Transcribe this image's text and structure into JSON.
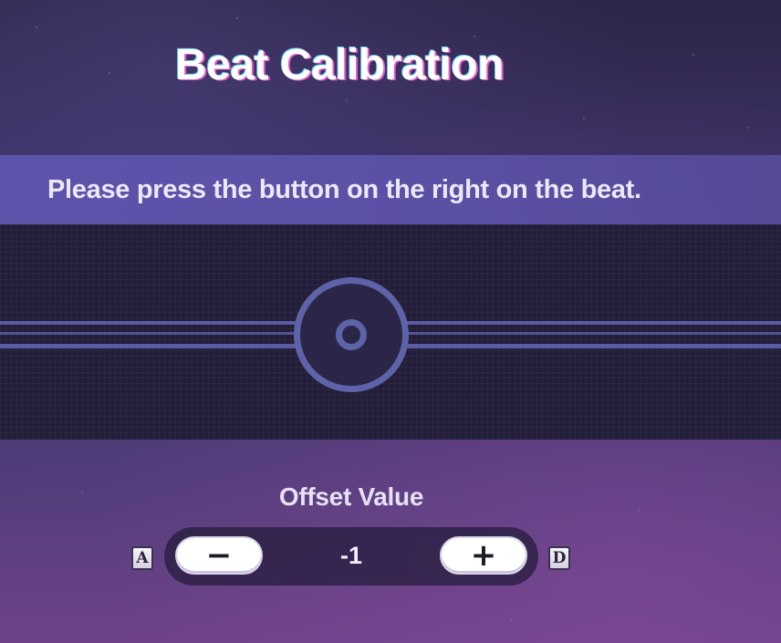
{
  "screen": {
    "title": "Beat Calibration",
    "instruction": "Please press the button on the right on the beat."
  },
  "track": {
    "target_icon": "beat-target-icon"
  },
  "offset": {
    "label": "Offset Value",
    "value": "-1",
    "decrease_glyph": "−",
    "increase_glyph": "+",
    "decrease_key": "A",
    "increase_key": "D"
  },
  "colors": {
    "accent_lane": "#5a5ca3",
    "banner": "#5f55af",
    "button_bg": "#ffffff"
  }
}
